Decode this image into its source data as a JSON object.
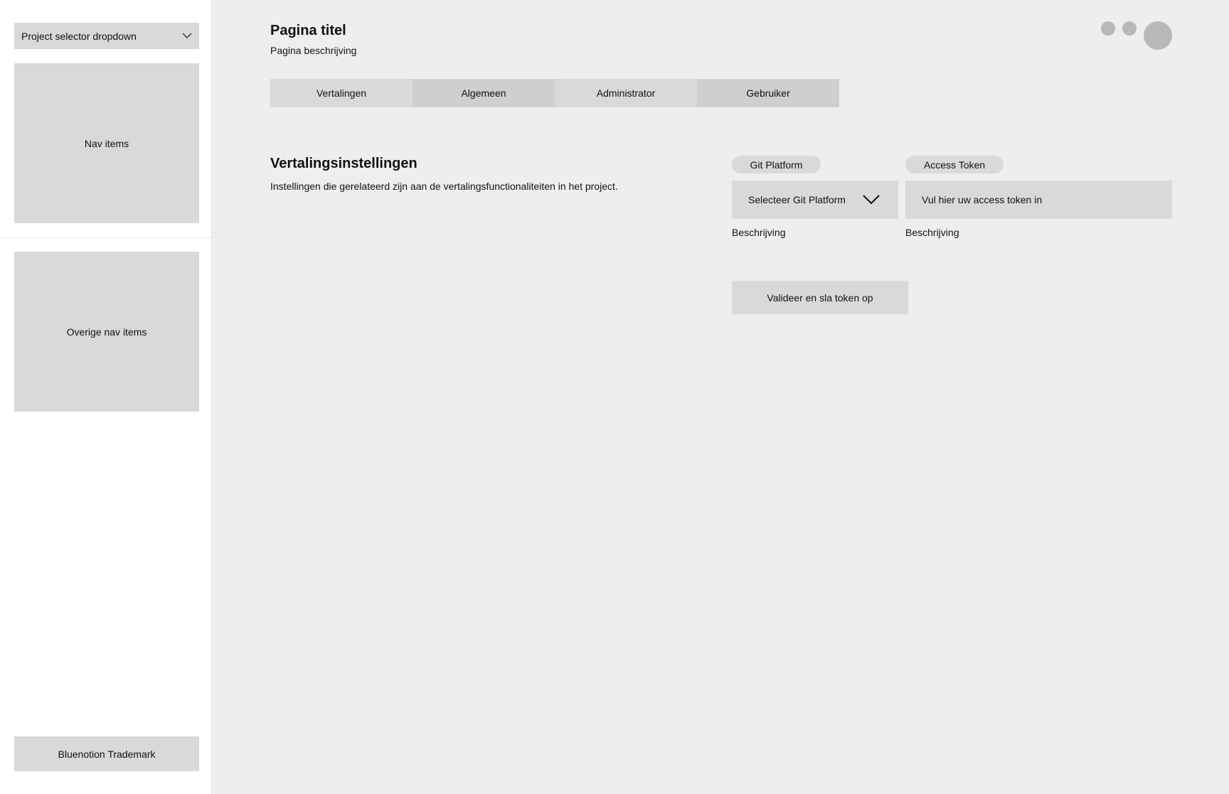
{
  "sidebar": {
    "project_selector": {
      "label": "Project selector dropdown",
      "icon": "chevron-down-icon"
    },
    "nav_items_label": "Nav items",
    "other_nav_items_label": "Overige nav items",
    "trademark": "Bluenotion Trademark"
  },
  "header": {
    "title": "Pagina titel",
    "description": "Pagina beschrijving",
    "icons": [
      "circle-icon",
      "circle-icon",
      "avatar"
    ]
  },
  "tabs": [
    {
      "label": "Vertalingen"
    },
    {
      "label": "Algemeen"
    },
    {
      "label": "Administrator"
    },
    {
      "label": "Gebruiker"
    }
  ],
  "section": {
    "title": "Vertalingsinstellingen",
    "description": "Instellingen die gerelateerd zijn aan de vertalingsfunctionaliteiten in het project."
  },
  "git_platform": {
    "label": "Git Platform",
    "select_value": "Selecteer Git Platform",
    "helper": "Beschrijving"
  },
  "access_token": {
    "label": "Access Token",
    "placeholder": "Vul hier uw access token in",
    "helper": "Beschrijving"
  },
  "save_button": {
    "label": "Valideer en sla token op"
  },
  "colors": {
    "background": "#eeeeee",
    "sidebar": "#ffffff",
    "block": "#d9d9d9",
    "block_alt": "#cfcfcf",
    "circle": "#b8b8b8",
    "text": "#111111"
  }
}
